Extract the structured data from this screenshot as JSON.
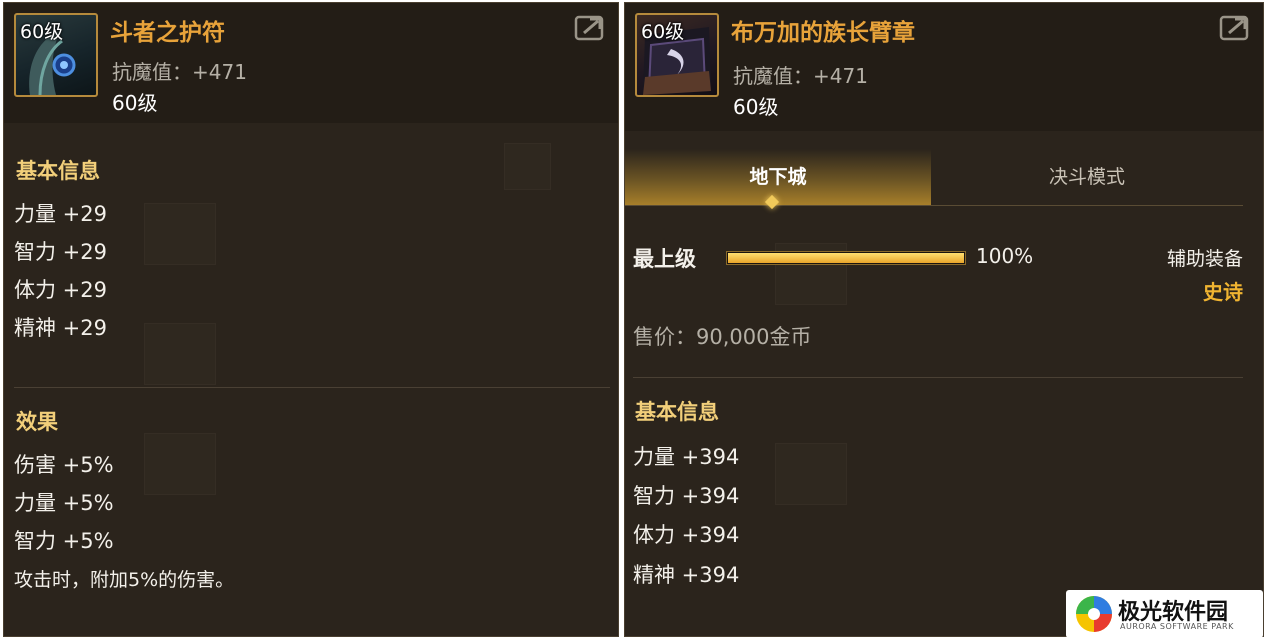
{
  "left": {
    "icon_level": "60级",
    "name": "斗者之护符",
    "magic_resist": "抗魔值：+471",
    "level": "60级",
    "basic_title": "基本信息",
    "stats": [
      "力量 +29",
      "智力 +29",
      "体力 +29",
      "精神 +29"
    ],
    "effect_title": "效果",
    "effects": [
      "伤害 +5%",
      "力量 +5%",
      "智力 +5%",
      "攻击时，附加5%的伤害。"
    ]
  },
  "right": {
    "icon_level": "60级",
    "name": "布万加的族长臂章",
    "magic_resist": "抗魔值：+471",
    "level": "60级",
    "tabs": [
      "地下城",
      "决斗模式"
    ],
    "active_tab": "地下城",
    "upgrade_label": "最上级",
    "upgrade_percent_text": "100%",
    "upgrade_fraction": 1.0,
    "equip_type": "辅助装备",
    "rarity": "史诗",
    "price": "售价：90,000金币",
    "basic_title": "基本信息",
    "stats": [
      "力量 +394",
      "智力 +394",
      "体力 +394",
      "精神 +394"
    ]
  },
  "watermark": {
    "cn": "极光软件园",
    "en": "AURORA SOFTWARE PARK"
  },
  "colors": {
    "panel_bg": "#2b241c",
    "header_bg": "#231d16",
    "item_name": "#e8a33a",
    "section_title": "#f2cf7a",
    "rarity_epic": "#f0b431",
    "progress_fill": "#e9a52a"
  },
  "icons": {
    "share": "share-arrow-icon",
    "left_item": "amulet-item-icon",
    "right_item": "armband-item-icon"
  }
}
